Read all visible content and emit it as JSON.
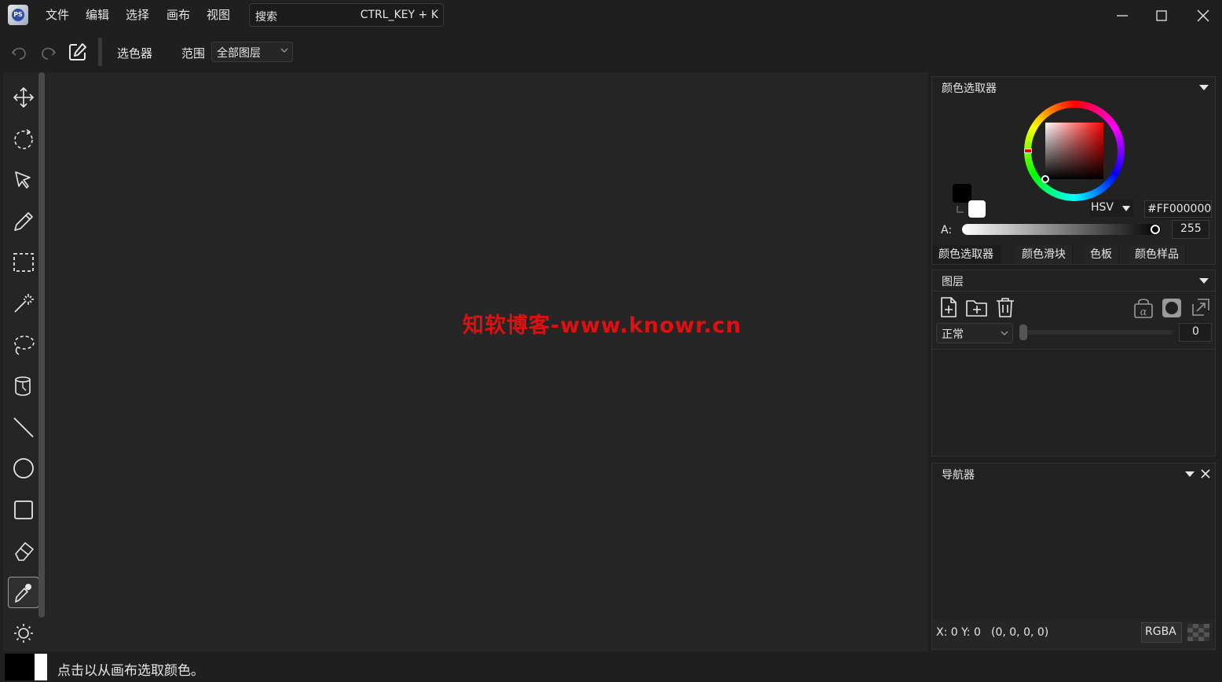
{
  "menu": {
    "items": [
      "文件",
      "编辑",
      "选择",
      "画布",
      "视图"
    ]
  },
  "search": {
    "placeholder": "搜索",
    "shortcut": "CTRL_KEY + K"
  },
  "toolbar": {
    "tool_label": "选色器",
    "range_label": "范围",
    "range_value": "全部图层"
  },
  "canvas": {
    "watermark": "知软博客-www.knowr.cn"
  },
  "color_picker": {
    "title": "颜色选取器",
    "mode": "HSV",
    "hex": "#FF000000",
    "alpha_label": "A:",
    "alpha_value": "255",
    "tabs": [
      "颜色选取器",
      "颜色滑块",
      "色板",
      "颜色样品"
    ],
    "primary_color": "#000000",
    "secondary_color": "#ffffff"
  },
  "layers": {
    "title": "图层",
    "blend_mode": "正常",
    "opacity_value": "0",
    "opacity_fraction": 0
  },
  "navigator": {
    "title": "导航器",
    "coords": "X: 0 Y: 0",
    "rgba_value": "(0, 0, 0, 0)",
    "format_button": "RGBA"
  },
  "status": {
    "message": "点击以从画布选取颜色。"
  },
  "colors": {
    "accent_watermark": "#e01010",
    "background": "#1f1f1f",
    "canvas": "#262626"
  },
  "icons": {
    "tools": [
      "move-icon",
      "rotate-icon",
      "pointer-icon",
      "pencil-icon",
      "rect-select-icon",
      "magic-wand-icon",
      "lasso-icon",
      "paint-bucket-icon",
      "line-icon",
      "ellipse-icon",
      "rectangle-icon",
      "eraser-icon",
      "color-picker-icon",
      "brightness-icon"
    ]
  }
}
